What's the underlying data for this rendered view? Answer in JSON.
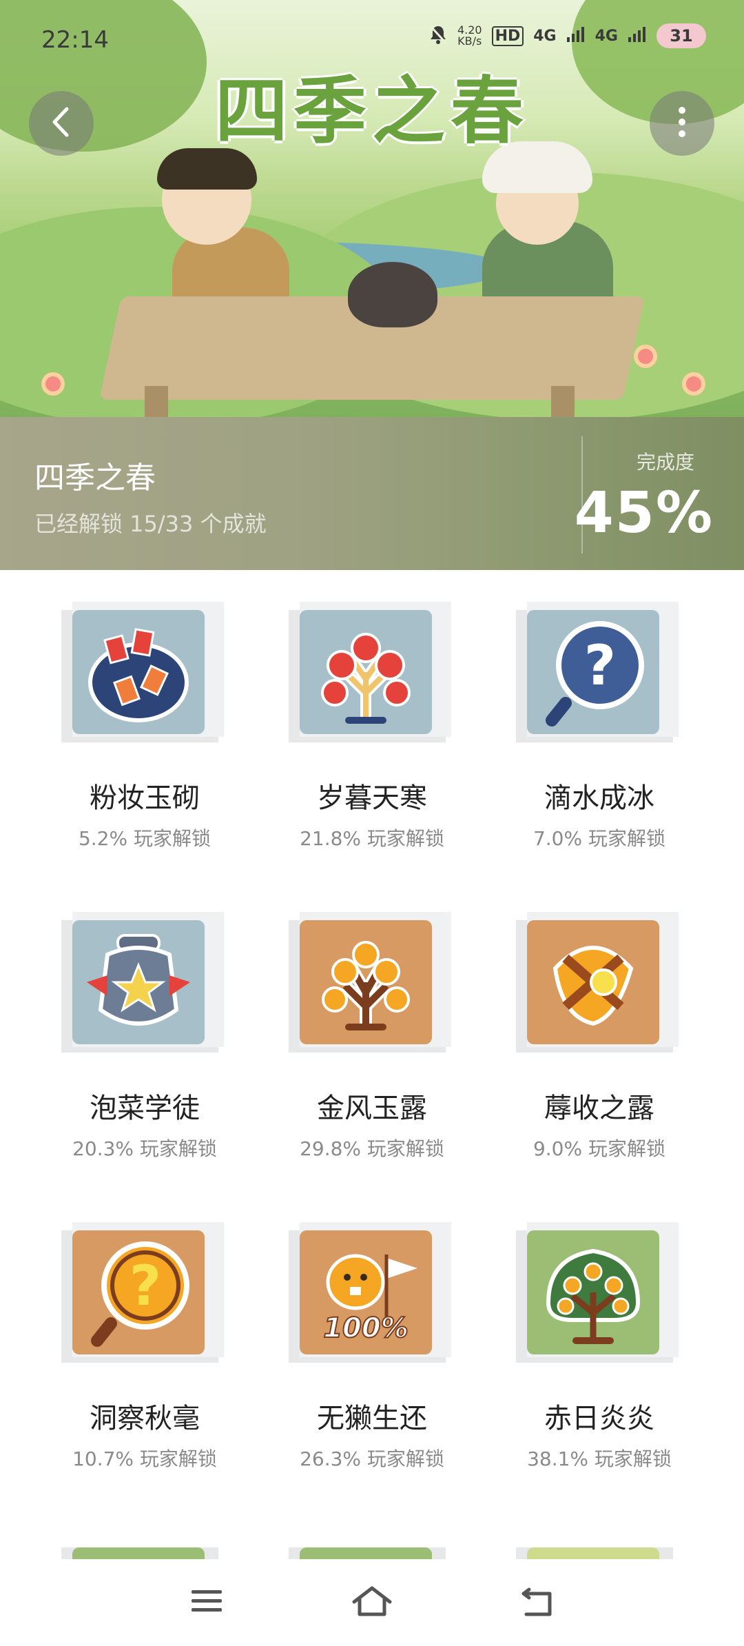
{
  "status_bar": {
    "time": "22:14",
    "net_speed": "4.20\nKB/s",
    "hd": "HD",
    "sim1": "4G",
    "sim2": "4G",
    "battery": "31"
  },
  "banner": {
    "title_art": "四季之春"
  },
  "info": {
    "name": "四季之春",
    "subtitle": "已经解锁 15/33 个成就",
    "progress_label": "完成度",
    "progress_value": "45%"
  },
  "achievements": [
    {
      "title": "粉妆玉砌",
      "percent": "5.2% 玩家解锁",
      "bg": "#a7bfc8",
      "icon": "red-envelope-bag-icon"
    },
    {
      "title": "岁暮天寒",
      "percent": "21.8% 玩家解锁",
      "bg": "#a7bfc8",
      "icon": "fortune-tree-icon"
    },
    {
      "title": "滴水成冰",
      "percent": "7.0% 玩家解锁",
      "bg": "#a7bfc8",
      "icon": "question-magnifier-icon"
    },
    {
      "title": "泡菜学徒",
      "percent": "20.3% 玩家解锁",
      "bg": "#a7bfc8",
      "icon": "pickle-jar-icon"
    },
    {
      "title": "金风玉露",
      "percent": "29.8% 玩家解锁",
      "bg": "#d79a62",
      "icon": "orange-tree-icon"
    },
    {
      "title": "蓐收之露",
      "percent": "9.0% 玩家解锁",
      "bg": "#d79a62",
      "icon": "ribbon-coin-icon"
    },
    {
      "title": "洞察秋毫",
      "percent": "10.7% 玩家解锁",
      "bg": "#d79a62",
      "icon": "question-magnifier-icon"
    },
    {
      "title": "无獭生还",
      "percent": "26.3% 玩家解锁",
      "bg": "#d79a62",
      "icon": "otter-flag-icon"
    },
    {
      "title": "赤日炎炎",
      "percent": "38.1% 玩家解锁",
      "bg": "#9bbd74",
      "icon": "fruit-tree-icon"
    }
  ],
  "partial_row_bgs": [
    "#9bbd74",
    "#9bbd74",
    "#cfdb8c"
  ],
  "badge_100": "100%"
}
